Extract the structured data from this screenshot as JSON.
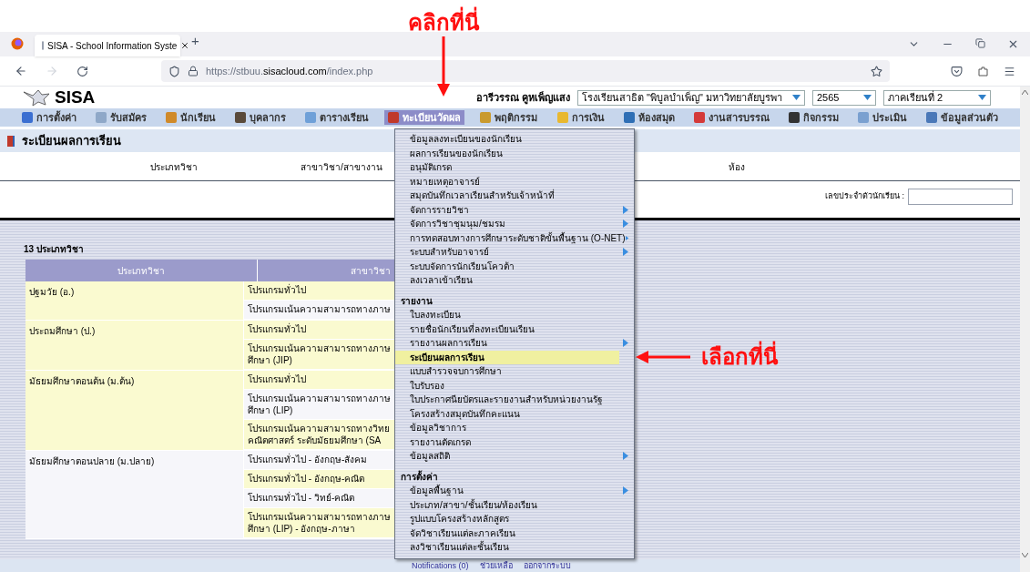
{
  "annotations": [
    {
      "kind": "down",
      "text": "คลิกที่นี่"
    },
    {
      "kind": "left",
      "text": "เลือกที่นี่"
    }
  ],
  "browser": {
    "tab_title": "SISA - School Information Syste",
    "new_tab": "+",
    "url_prefix": "https://stbuu.",
    "url_domain": "sisacloud.com",
    "url_path": "/index.php"
  },
  "header": {
    "logo": "SISA",
    "user": "อารีวรรณ คูหเพ็ญแสง",
    "school": "โรงเรียนสาธิต \"พิบูลบำเพ็ญ\" มหาวิทยาลัยบูรพา",
    "year": "2565",
    "term": "ภาคเรียนที่ 2"
  },
  "menubar": [
    {
      "label": "การตั้งค่า",
      "selected": false,
      "color": "#3b6fd1"
    },
    {
      "label": "รับสมัคร",
      "selected": false,
      "color": "#8fa8c8"
    },
    {
      "label": "นักเรียน",
      "selected": false,
      "color": "#d08a2a"
    },
    {
      "label": "บุคลากร",
      "selected": false,
      "color": "#5a4a3a"
    },
    {
      "label": "ตารางเรียน",
      "selected": false,
      "color": "#6fa0d8"
    },
    {
      "label": "ทะเบียนวัดผล",
      "selected": true,
      "color": "#c0392b"
    },
    {
      "label": "พฤติกรรม",
      "selected": false,
      "color": "#c99a2e"
    },
    {
      "label": "การเงิน",
      "selected": false,
      "color": "#e8b830"
    },
    {
      "label": "ห้องสมุด",
      "selected": false,
      "color": "#2f6fb5"
    },
    {
      "label": "งานสารบรรณ",
      "selected": false,
      "color": "#d43a3a"
    },
    {
      "label": "กิจกรรม",
      "selected": false,
      "color": "#333333"
    },
    {
      "label": "ประเมิน",
      "selected": false,
      "color": "#7aa0d0"
    },
    {
      "label": "ข้อมูลส่วนตัว",
      "selected": false,
      "color": "#4a78b8"
    }
  ],
  "page_title": "ระเบียนผลการเรียน",
  "filters": {
    "columns": [
      "ประเภทวิชา",
      "สาขาวิชา/สาขางาน",
      "ห้อง"
    ],
    "student_id_label": "เลขประจำตัวนักเรียน :"
  },
  "table": {
    "count": "13 ประเภทวิชา",
    "columns": [
      "ประเภทวิชา",
      "สาขาวิชา"
    ],
    "groups": [
      {
        "name": "ปฐมวัย (อ.)",
        "highlighted": true,
        "rows": [
          {
            "lines": [
              "โปรแกรมทั่วไป"
            ],
            "highlighted": true
          },
          {
            "lines": [
              "โปรแกรมเน้นความสามารถทางภาษ"
            ],
            "highlighted": false
          }
        ]
      },
      {
        "name": "ประถมศึกษา (ป.)",
        "highlighted": true,
        "rows": [
          {
            "lines": [
              "โปรแกรมทั่วไป"
            ],
            "highlighted": true
          },
          {
            "lines": [
              "โปรแกรมเน้นความสามารถทางภาษ",
              "ศึกษา (JIP)"
            ],
            "highlighted": true
          }
        ]
      },
      {
        "name": "มัธยมศึกษาตอนต้น (ม.ต้น)",
        "highlighted": true,
        "rows": [
          {
            "lines": [
              "โปรแกรมทั่วไป"
            ],
            "highlighted": true
          },
          {
            "lines": [
              "โปรแกรมเน้นความสามารถทางภาษ",
              "ศึกษา (LIP)"
            ],
            "highlighted": false
          },
          {
            "lines": [
              "โปรแกรมเน้นความสามารถทางวิทย",
              "คณิตศาสตร์ ระดับมัธยมศึกษา (SA"
            ],
            "highlighted": true
          }
        ]
      },
      {
        "name": "มัธยมศึกษาตอนปลาย (ม.ปลาย)",
        "highlighted": false,
        "rows": [
          {
            "lines": [
              "โปรแกรมทั่วไป - อังกฤษ-สังคม"
            ],
            "highlighted": false
          },
          {
            "lines": [
              "โปรแกรมทั่วไป - อังกฤษ-คณิต"
            ],
            "highlighted": true
          },
          {
            "lines": [
              "โปรแกรมทั่วไป - วิทย์-คณิต"
            ],
            "highlighted": false
          },
          {
            "lines": [
              "โปรแกรมเน้นความสามารถทางภาษ",
              "ศึกษา (LIP) - อังกฤษ-ภาษา"
            ],
            "highlighted": true
          }
        ]
      }
    ]
  },
  "dropdown": {
    "sections": [
      {
        "items": [
          {
            "label": "ข้อมูลลงทะเบียนของนักเรียน",
            "submenu": false,
            "selected": false
          },
          {
            "label": "ผลการเรียนของนักเรียน",
            "submenu": false,
            "selected": false
          },
          {
            "label": "อนุมัติเกรด",
            "submenu": false,
            "selected": false
          },
          {
            "label": "หมายเหตุอาจารย์",
            "submenu": false,
            "selected": false
          },
          {
            "label": "สมุดบันทึกเวลาเรียนสำหรับเจ้าหน้าที่",
            "submenu": false,
            "selected": false
          },
          {
            "label": "จัดการรายวิชา",
            "submenu": true,
            "selected": false
          },
          {
            "label": "จัดการวิชาชุมนุม/ชมรม",
            "submenu": true,
            "selected": false
          },
          {
            "label": "การทดสอบทางการศึกษาระดับชาติขั้นพื้นฐาน (O-NET)",
            "submenu": true,
            "selected": false
          },
          {
            "label": "ระบบสำหรับอาจารย์",
            "submenu": true,
            "selected": false
          },
          {
            "label": "ระบบจัดการนักเรียนโควต้า",
            "submenu": false,
            "selected": false
          },
          {
            "label": "ลงเวลาเข้าเรียน",
            "submenu": false,
            "selected": false
          }
        ]
      },
      {
        "heading": "รายงาน",
        "items": [
          {
            "label": "ใบลงทะเบียน",
            "submenu": false,
            "selected": false
          },
          {
            "label": "รายชื่อนักเรียนที่ลงทะเบียนเรียน",
            "submenu": false,
            "selected": false
          },
          {
            "label": "รายงานผลการเรียน",
            "submenu": true,
            "selected": false
          },
          {
            "label": "ระเบียนผลการเรียน",
            "submenu": false,
            "selected": true
          },
          {
            "label": "แบบสำรวจจบการศึกษา",
            "submenu": false,
            "selected": false
          },
          {
            "label": "ใบรับรอง",
            "submenu": false,
            "selected": false
          },
          {
            "label": "ใบประกาศนียบัตรและรายงานสำหรับหน่วยงานรัฐ",
            "submenu": false,
            "selected": false
          },
          {
            "label": "โครงสร้างสมุดบันทึกคะแนน",
            "submenu": false,
            "selected": false
          },
          {
            "label": "ข้อมูลวิชาการ",
            "submenu": false,
            "selected": false
          },
          {
            "label": "รายงานตัดเกรด",
            "submenu": false,
            "selected": false
          },
          {
            "label": "ข้อมูลสถิติ",
            "submenu": true,
            "selected": false
          }
        ]
      },
      {
        "heading": "การตั้งค่า",
        "items": [
          {
            "label": "ข้อมูลพื้นฐาน",
            "submenu": true,
            "selected": false
          },
          {
            "label": "ประเภท/สาขา/ชั้นเรียน/ห้องเรียน",
            "submenu": false,
            "selected": false
          },
          {
            "label": "รูปแบบโครงสร้างหลักสูตร",
            "submenu": false,
            "selected": false
          },
          {
            "label": "จัดวิชาเรียนแต่ละภาคเรียน",
            "submenu": false,
            "selected": false
          },
          {
            "label": "ลงวิชาเรียนแต่ละชั้นเรียน",
            "submenu": false,
            "selected": false
          }
        ]
      }
    ]
  },
  "footer": [
    "Notifications (0)",
    "ช่วยเหลือ",
    "ออกจากระบบ"
  ]
}
